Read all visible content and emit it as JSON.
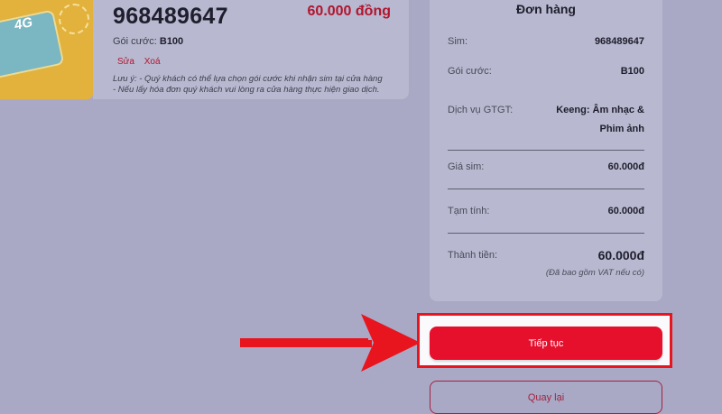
{
  "product": {
    "phone_number": "968489647",
    "price": "60.000 đồng",
    "plan_label": "Gói cước:",
    "plan_value": "B100",
    "edit_label": "Sửa",
    "delete_label": "Xoá",
    "note_line1": "Lưu ý: - Quý khách có thể lựa chọn gói cước khi nhận sim tại cửa hàng",
    "note_line2": "- Nếu lấy hóa đơn quý khách vui lòng ra cửa hàng thực hiện giao dịch.",
    "card_logo": "4G"
  },
  "order": {
    "title": "Đơn hàng",
    "sim_label": "Sim:",
    "sim_value": "968489647",
    "plan_label": "Gói cước:",
    "plan_value": "B100",
    "vas_label": "Dịch vụ GTGT:",
    "vas_value_line1": "Keeng: Âm nhạc &",
    "vas_value_line2": "Phim ảnh",
    "sim_price_label": "Giá sim:",
    "sim_price_value": "60.000đ",
    "subtotal_label": "Tạm tính:",
    "subtotal_value": "60.000đ",
    "total_label": "Thành tiền:",
    "total_value": "60.000đ",
    "vat_note": "(Đã bao gồm VAT nếu có)"
  },
  "buttons": {
    "continue_label": "Tiếp tục",
    "back_label": "Quay lại"
  },
  "colors": {
    "accent": "#e6102d",
    "price": "#b0162e",
    "annotation": "#e8141e"
  },
  "icons": {
    "arrow": "arrow-right-icon"
  }
}
